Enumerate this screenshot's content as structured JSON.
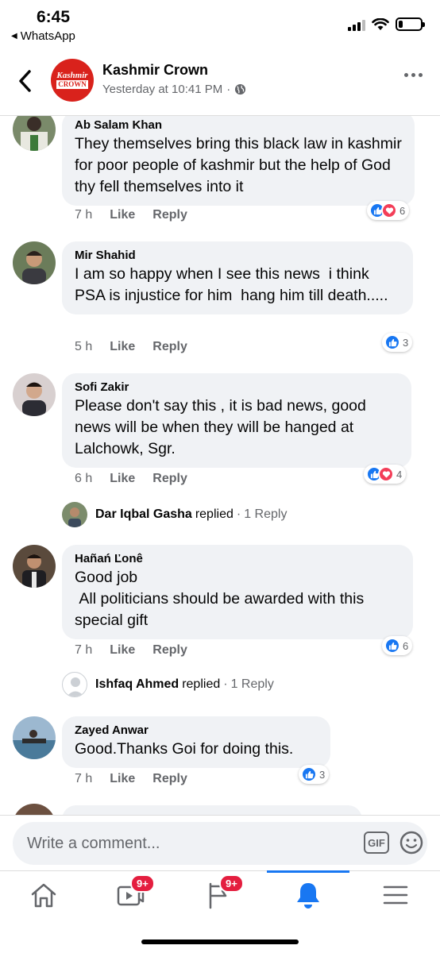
{
  "status": {
    "time": "6:45",
    "back_app": "WhatsApp",
    "battery_level": 0.2
  },
  "header": {
    "logo_line1": "Kashmir",
    "logo_line2": "CROWN",
    "page_name": "Kashmir Crown",
    "post_time": "Yesterday at 10:41 PM",
    "separator": "·",
    "privacy_icon": "globe-icon",
    "back_icon": "chevron-left-icon",
    "more_icon": "more-horizontal-icon"
  },
  "comments": [
    {
      "author": "Ab Salam Khan",
      "text": "They themselves bring this black law in kashmir for poor people of kashmir but the help of God thy fell themselves into it",
      "time": "7 h",
      "like_label": "Like",
      "reply_label": "Reply",
      "reactions": [
        "like",
        "love"
      ],
      "reaction_count": "6"
    },
    {
      "author": "Mir Shahid",
      "text": "I am so happy when I see this news  i think PSA is injustice for him  hang him till death.....",
      "time": "5 h",
      "like_label": "Like",
      "reply_label": "Reply",
      "reactions": [
        "like"
      ],
      "reaction_count": "3"
    },
    {
      "author": "Sofi Zakir",
      "text": "Please don't say this , it is bad news, good news will be when they will be hanged at Lalchowk, Sgr.",
      "time": "6 h",
      "like_label": "Like",
      "reply_label": "Reply",
      "reactions": [
        "like",
        "love"
      ],
      "reaction_count": "4",
      "reply_summary": {
        "name": "Dar Iqbal Gasha",
        "action": "replied",
        "separator": "·",
        "count": "1 Reply"
      }
    },
    {
      "author": "Hañań Ľonê",
      "text": "Good job\n All politicians should be awarded with this special gift",
      "time": "7 h",
      "like_label": "Like",
      "reply_label": "Reply",
      "reactions": [
        "like"
      ],
      "reaction_count": "6",
      "reply_summary": {
        "name": "Ishfaq Ahmed",
        "action": "replied",
        "separator": "·",
        "count": "1 Reply"
      }
    },
    {
      "author": "Zayed Anwar",
      "text": "Good.Thanks Goi for doing this.",
      "time": "7 h",
      "like_label": "Like",
      "reply_label": "Reply",
      "reactions": [
        "like"
      ],
      "reaction_count": "3"
    }
  ],
  "composer": {
    "placeholder": "Write a comment...",
    "gif_label": "GIF",
    "emoji_icon": "emoji-icon"
  },
  "tabbar": {
    "tabs": [
      {
        "name": "home",
        "icon": "home-icon"
      },
      {
        "name": "watch",
        "icon": "video-icon",
        "badge": "9+"
      },
      {
        "name": "pages",
        "icon": "flag-icon",
        "badge": "9+"
      },
      {
        "name": "notifications",
        "icon": "bell-icon",
        "active": true
      },
      {
        "name": "menu",
        "icon": "menu-icon"
      }
    ]
  },
  "colors": {
    "accent": "#1877f2",
    "love": "#f33e58",
    "badge": "#e41e3f",
    "bubble": "#f0f2f5",
    "secondary_text": "#65676b"
  }
}
